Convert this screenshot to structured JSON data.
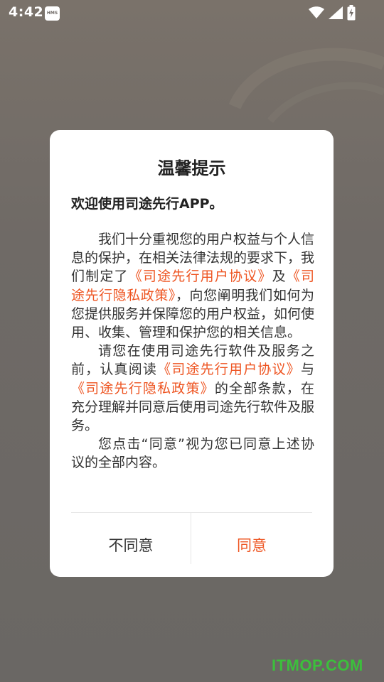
{
  "status_bar": {
    "time": "4:42",
    "hms_label": "HMS"
  },
  "dialog": {
    "title": "温馨提示",
    "welcome": "欢迎使用司途先行APP。",
    "paragraph1": {
      "text_a": "我们十分重视您的用户权益与个人信息的保护，在相关法律法规的要求下，我们制定了",
      "link_user_agreement": "《司途先行用户协议》",
      "text_b": "及",
      "link_privacy_policy": "《司途先行隐私政策》",
      "text_c": "，向您阐明我们如何为您提供服务并保障您的用户权益，如何使用、收集、管理和保护您的相关信息。"
    },
    "paragraph2": {
      "text_a": "请您在使用司途先行软件及服务之前，认真阅读",
      "link_user_agreement": "《司途先行用户协议》",
      "text_b": "与",
      "link_privacy_policy": "《司途先行隐私政策》",
      "text_c": "的全部条款，在充分理解并同意后使用司途先行软件及服务。"
    },
    "paragraph3": {
      "text": "您点击“同意”视为您已同意上述协议的全部内容。"
    },
    "buttons": {
      "disagree_label": "不同意",
      "agree_label": "同意"
    }
  },
  "watermark": "ITMOP.COM",
  "colors": {
    "link": "#ee5522",
    "agree": "#ee5522",
    "watermark": "#3cbf3c"
  }
}
